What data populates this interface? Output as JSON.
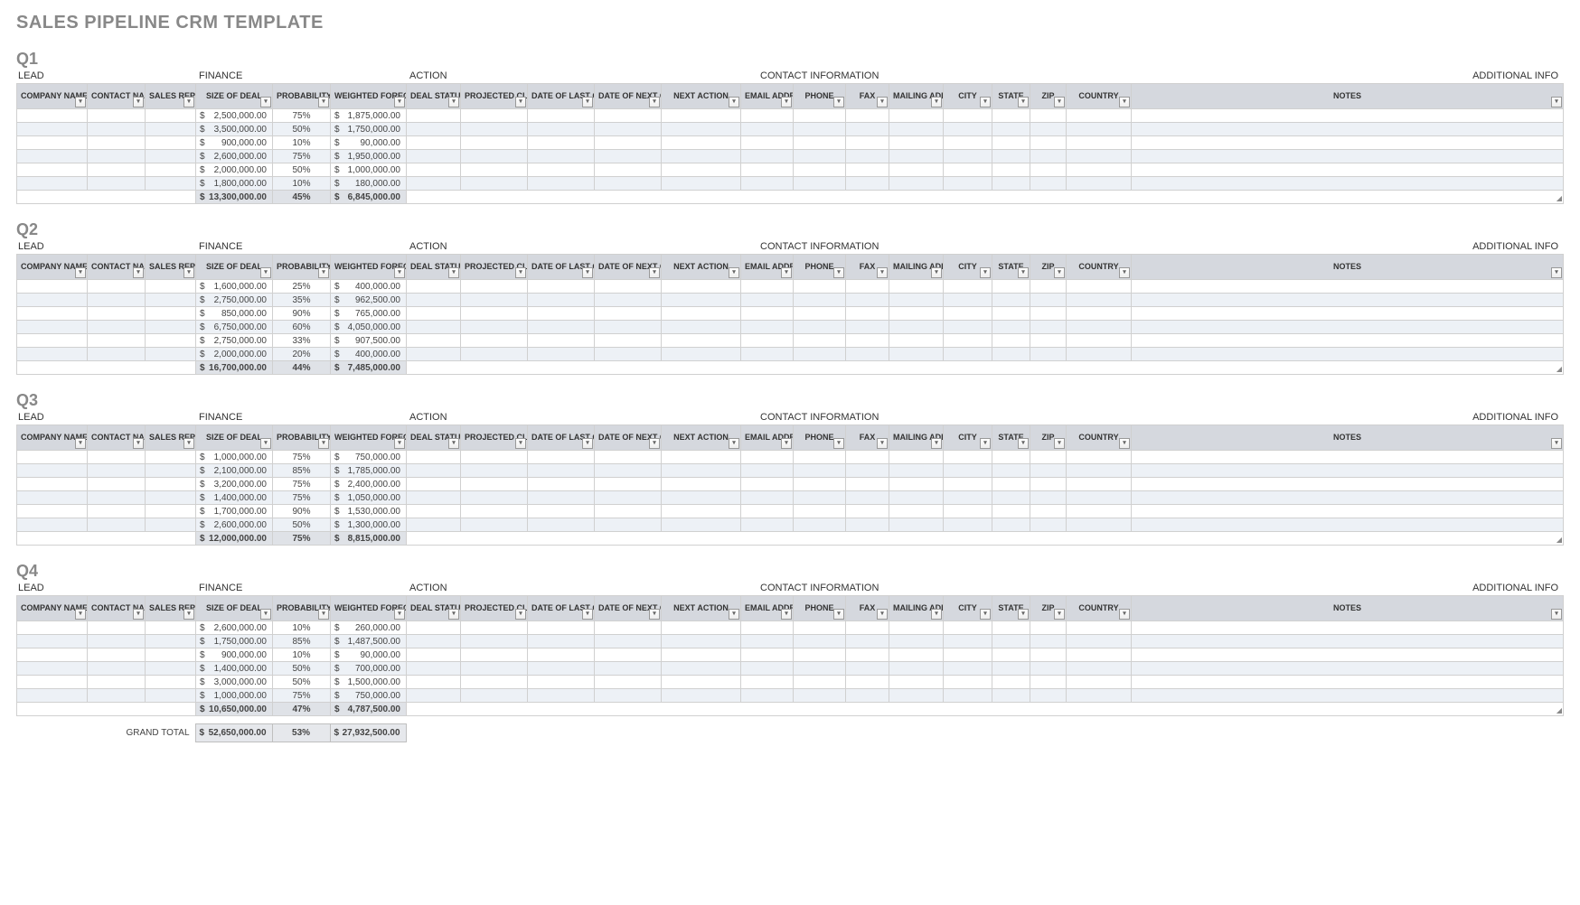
{
  "title": "SALES PIPELINE CRM TEMPLATE",
  "sections": {
    "lead": "LEAD",
    "finance": "FINANCE",
    "action": "ACTION",
    "contact": "CONTACT INFORMATION",
    "additional": "ADDITIONAL INFO"
  },
  "columns": {
    "company": "COMPANY NAME",
    "contact": "CONTACT NAME",
    "rep": "SALES REP",
    "size": "SIZE OF DEAL",
    "prob": "PROBABILITY OF DEAL",
    "wf": "WEIGHTED FORECAST",
    "status": "DEAL STATUS",
    "proj": "PROJECTED CLOSING DATE",
    "lastc": "DATE OF LAST CONTACT",
    "nextc": "DATE OF NEXT CONTACT",
    "nexta": "NEXT ACTION",
    "email": "EMAIL ADDRESS",
    "phone": "PHONE",
    "fax": "FAX",
    "mail": "MAILING ADDRESS",
    "city": "CITY",
    "state": "STATE",
    "zip": "ZIP",
    "country": "COUNTRY",
    "notes": "NOTES"
  },
  "quarters": [
    {
      "name": "Q1",
      "rows": [
        {
          "size": "2,500,000.00",
          "prob": "75%",
          "wf": "1,875,000.00"
        },
        {
          "size": "3,500,000.00",
          "prob": "50%",
          "wf": "1,750,000.00"
        },
        {
          "size": "900,000.00",
          "prob": "10%",
          "wf": "90,000.00"
        },
        {
          "size": "2,600,000.00",
          "prob": "75%",
          "wf": "1,950,000.00"
        },
        {
          "size": "2,000,000.00",
          "prob": "50%",
          "wf": "1,000,000.00"
        },
        {
          "size": "1,800,000.00",
          "prob": "10%",
          "wf": "180,000.00"
        }
      ],
      "total": {
        "size": "13,300,000.00",
        "prob": "45%",
        "wf": "6,845,000.00"
      }
    },
    {
      "name": "Q2",
      "rows": [
        {
          "size": "1,600,000.00",
          "prob": "25%",
          "wf": "400,000.00"
        },
        {
          "size": "2,750,000.00",
          "prob": "35%",
          "wf": "962,500.00"
        },
        {
          "size": "850,000.00",
          "prob": "90%",
          "wf": "765,000.00"
        },
        {
          "size": "6,750,000.00",
          "prob": "60%",
          "wf": "4,050,000.00"
        },
        {
          "size": "2,750,000.00",
          "prob": "33%",
          "wf": "907,500.00"
        },
        {
          "size": "2,000,000.00",
          "prob": "20%",
          "wf": "400,000.00"
        }
      ],
      "total": {
        "size": "16,700,000.00",
        "prob": "44%",
        "wf": "7,485,000.00"
      }
    },
    {
      "name": "Q3",
      "rows": [
        {
          "size": "1,000,000.00",
          "prob": "75%",
          "wf": "750,000.00"
        },
        {
          "size": "2,100,000.00",
          "prob": "85%",
          "wf": "1,785,000.00"
        },
        {
          "size": "3,200,000.00",
          "prob": "75%",
          "wf": "2,400,000.00"
        },
        {
          "size": "1,400,000.00",
          "prob": "75%",
          "wf": "1,050,000.00"
        },
        {
          "size": "1,700,000.00",
          "prob": "90%",
          "wf": "1,530,000.00"
        },
        {
          "size": "2,600,000.00",
          "prob": "50%",
          "wf": "1,300,000.00"
        }
      ],
      "total": {
        "size": "12,000,000.00",
        "prob": "75%",
        "wf": "8,815,000.00"
      }
    },
    {
      "name": "Q4",
      "rows": [
        {
          "size": "2,600,000.00",
          "prob": "10%",
          "wf": "260,000.00"
        },
        {
          "size": "1,750,000.00",
          "prob": "85%",
          "wf": "1,487,500.00"
        },
        {
          "size": "900,000.00",
          "prob": "10%",
          "wf": "90,000.00"
        },
        {
          "size": "1,400,000.00",
          "prob": "50%",
          "wf": "700,000.00"
        },
        {
          "size": "3,000,000.00",
          "prob": "50%",
          "wf": "1,500,000.00"
        },
        {
          "size": "1,000,000.00",
          "prob": "75%",
          "wf": "750,000.00"
        }
      ],
      "total": {
        "size": "10,650,000.00",
        "prob": "47%",
        "wf": "4,787,500.00"
      }
    }
  ],
  "grand": {
    "label": "GRAND TOTAL",
    "size": "52,650,000.00",
    "prob": "53%",
    "wf": "27,932,500.00"
  }
}
